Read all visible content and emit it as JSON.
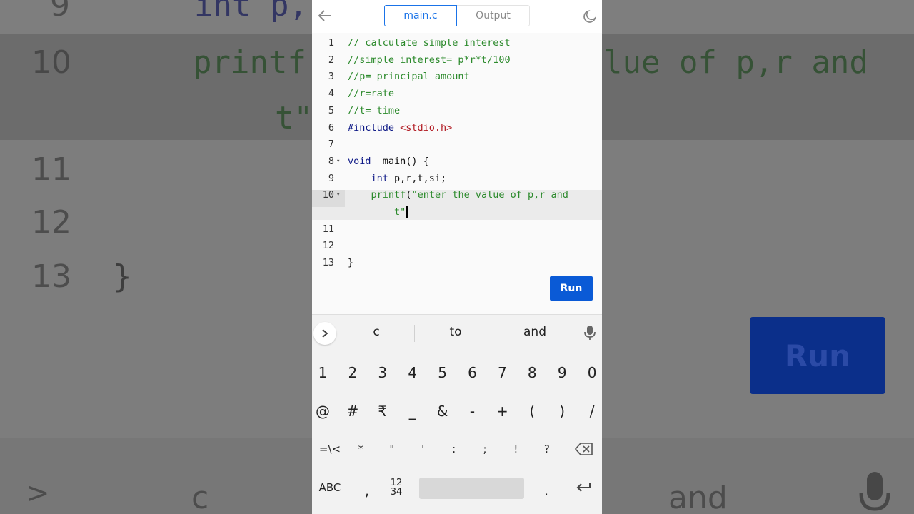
{
  "background": {
    "lines": [
      {
        "num": "9",
        "code": "int p,"
      },
      {
        "num": "10",
        "code": "printf",
        "code_right": "lue of p,r and"
      },
      {
        "num": "",
        "code": "t\""
      },
      {
        "num": "11",
        "code": ""
      },
      {
        "num": "12",
        "code": ""
      },
      {
        "num": "13",
        "code": "}"
      }
    ],
    "run_label": "Run",
    "sugg_left": "c",
    "sugg_right": "and"
  },
  "tabs": {
    "main": "main.c",
    "output": "Output"
  },
  "editor": {
    "lines": [
      {
        "num": "1",
        "segments": [
          {
            "t": "// calculate simple interest",
            "c": "cm"
          }
        ]
      },
      {
        "num": "2",
        "segments": [
          {
            "t": "//simple interest= p*r*t/100",
            "c": "cm"
          }
        ]
      },
      {
        "num": "3",
        "segments": [
          {
            "t": "//p= principal amount",
            "c": "cm"
          }
        ]
      },
      {
        "num": "4",
        "segments": [
          {
            "t": "//r=rate",
            "c": "cm"
          }
        ]
      },
      {
        "num": "5",
        "segments": [
          {
            "t": "//t= time",
            "c": "cm"
          }
        ]
      },
      {
        "num": "6",
        "segments": [
          {
            "t": "#include ",
            "c": "inc"
          },
          {
            "t": "<stdio.h>",
            "c": "hdr"
          }
        ]
      },
      {
        "num": "7",
        "segments": []
      },
      {
        "num": "8",
        "fold": true,
        "segments": [
          {
            "t": "void",
            "c": "kw"
          },
          {
            "t": "  main() {",
            "c": "pl"
          }
        ]
      },
      {
        "num": "9",
        "segments": [
          {
            "t": "    ",
            "c": "pl"
          },
          {
            "t": "int",
            "c": "kw"
          },
          {
            "t": " p,r,t,si;",
            "c": "pl"
          }
        ]
      },
      {
        "num": "10",
        "fold": true,
        "segments": [
          {
            "t": "    ",
            "c": "pl"
          },
          {
            "t": "printf",
            "c": "fn"
          },
          {
            "t": "(",
            "c": "pl"
          },
          {
            "t": "\"enter the value of p,r and",
            "c": "str"
          }
        ]
      },
      {
        "num": "",
        "segments": [
          {
            "t": "        ",
            "c": "pl"
          },
          {
            "t": "t\"",
            "c": "str"
          }
        ],
        "cursor": true
      },
      {
        "num": "11",
        "segments": []
      },
      {
        "num": "12",
        "segments": []
      },
      {
        "num": "13",
        "segments": [
          {
            "t": "}",
            "c": "pl"
          }
        ]
      }
    ]
  },
  "run_label": "Run",
  "keyboard": {
    "suggestions": [
      "c",
      "to",
      "and"
    ],
    "row1": [
      "1",
      "2",
      "3",
      "4",
      "5",
      "6",
      "7",
      "8",
      "9",
      "0"
    ],
    "row2": [
      "@",
      "#",
      "₹",
      "_",
      "&",
      "-",
      "+",
      "(",
      ")",
      "/"
    ],
    "row3": [
      "=\\<",
      "*",
      "\"",
      "'",
      ":",
      ";",
      "!",
      "?"
    ],
    "abc": "ABC",
    "comma": ",",
    "numpad_top": "12",
    "numpad_bottom": "34",
    "period": "."
  },
  "icons": {
    "back": "arrow-left-icon",
    "theme": "moon-icon",
    "expand": "chevron-right-icon",
    "mic": "mic-icon",
    "backspace": "backspace-icon",
    "enter": "enter-icon"
  },
  "colors": {
    "accent": "#1a73e8",
    "run": "#0a5ad6",
    "comment": "#2c8a2c",
    "keyword": "#0f1a87",
    "header": "#b0171f"
  }
}
